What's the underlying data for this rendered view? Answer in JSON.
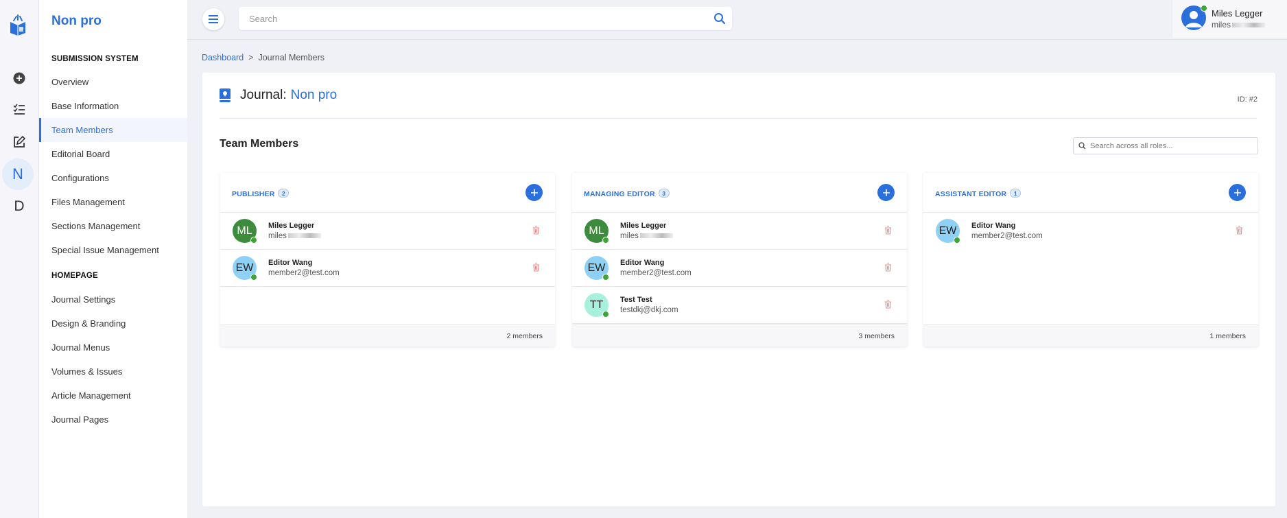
{
  "rail": {
    "items": [
      {
        "icon": "add-circle-icon"
      },
      {
        "icon": "checklist-icon"
      },
      {
        "icon": "edit-icon"
      },
      {
        "letter": "N"
      },
      {
        "letter": "D"
      }
    ]
  },
  "nav": {
    "title": "Non pro",
    "sections": [
      {
        "heading": "SUBMISSION SYSTEM",
        "items": [
          "Overview",
          "Base Information",
          "Team Members",
          "Editorial Board",
          "Configurations",
          "Files Management",
          "Sections Management",
          "Special Issue Management"
        ]
      },
      {
        "heading": "HOMEPAGE",
        "items": [
          "Journal Settings",
          "Design & Branding",
          "Journal Menus",
          "Volumes & Issues",
          "Article Management",
          "Journal Pages"
        ]
      }
    ],
    "active_item": "Team Members"
  },
  "topbar": {
    "search_placeholder": "Search",
    "user": {
      "name": "Miles Legger",
      "email_visible": "miles"
    }
  },
  "breadcrumb": {
    "home": "Dashboard",
    "separator": ">",
    "current": "Journal Members"
  },
  "journal": {
    "label": "Journal:",
    "name": "Non pro",
    "id": "ID: #2"
  },
  "team": {
    "title": "Team Members",
    "search_placeholder": "Search across all roles..."
  },
  "roles": [
    {
      "name": "PUBLISHER",
      "count": "2",
      "footer": "2 members",
      "members": [
        {
          "initials": "ML",
          "name": "Miles Legger",
          "email": "miles",
          "color": "#3d8b3d",
          "text_color": "#ffffff"
        },
        {
          "initials": "EW",
          "name": "Editor Wang",
          "email": "member2@test.com",
          "color": "#8fd1f5",
          "text_color": "#222222"
        }
      ]
    },
    {
      "name": "MANAGING EDITOR",
      "count": "3",
      "footer": "3 members",
      "members": [
        {
          "initials": "ML",
          "name": "Miles Legger",
          "email": "miles",
          "color": "#3d8b3d",
          "text_color": "#ffffff"
        },
        {
          "initials": "EW",
          "name": "Editor Wang",
          "email": "member2@test.com",
          "color": "#8fd1f5",
          "text_color": "#222222"
        },
        {
          "initials": "TT",
          "name": "Test Test",
          "email": "testdkj@dkj.com",
          "color": "#a6f0dc",
          "text_color": "#222222"
        }
      ]
    },
    {
      "name": "ASSISTANT EDITOR",
      "count": "1",
      "footer": "1 members",
      "members": [
        {
          "initials": "EW",
          "name": "Editor Wang",
          "email": "member2@test.com",
          "color": "#8fd1f5",
          "text_color": "#222222"
        }
      ]
    }
  ],
  "colors": {
    "accent": "#2a6fdb",
    "online": "#3fa535",
    "danger": "#e88a8a"
  }
}
